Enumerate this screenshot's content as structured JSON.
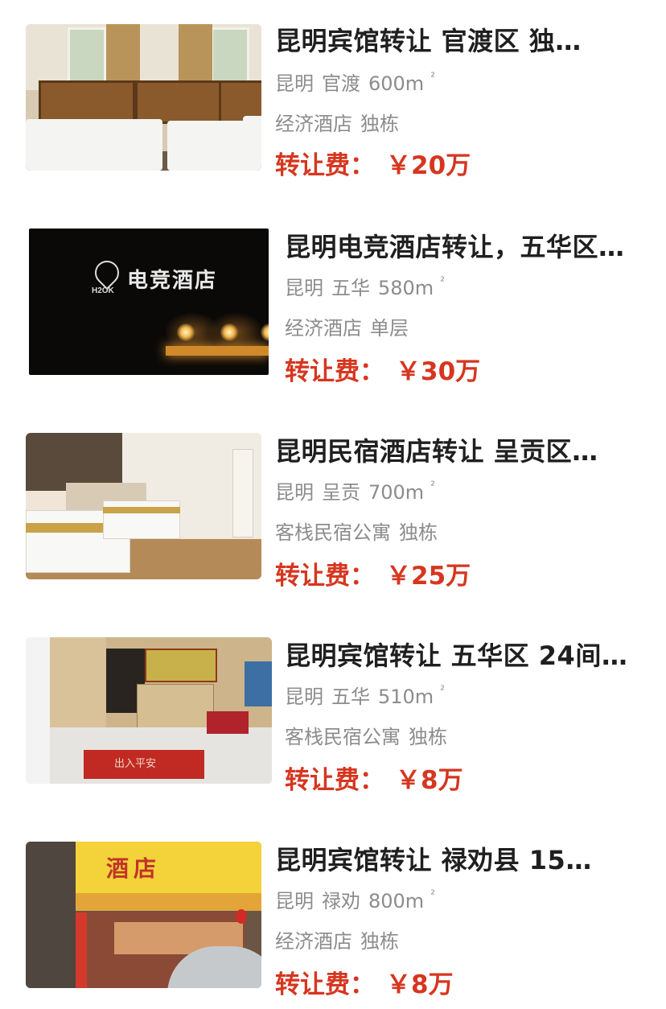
{
  "price_label": "转让费：",
  "listings": [
    {
      "title": "昆明宾馆转让 官渡区 独…",
      "city": "昆明",
      "district": "官渡",
      "area": "600m",
      "area_sup": "²",
      "type": "经济酒店",
      "building": "独栋",
      "price": "￥20万"
    },
    {
      "title": "昆明电竞酒店转让，五华区…",
      "city": "昆明",
      "district": "五华",
      "area": "580m",
      "area_sup": "²",
      "type": "经济酒店",
      "building": "单层",
      "price": "￥30万",
      "image_sign": "电竞酒店",
      "image_logo": "H2OK"
    },
    {
      "title": "昆明民宿酒店转让 呈贡区…",
      "city": "昆明",
      "district": "呈贡",
      "area": "700m",
      "area_sup": "²",
      "type": "客栈民宿公寓",
      "building": "独栋",
      "price": "￥25万"
    },
    {
      "title": "昆明宾馆转让 五华区 24间…",
      "city": "昆明",
      "district": "五华",
      "area": "510m",
      "area_sup": "²",
      "type": "客栈民宿公寓",
      "building": "独栋",
      "price": "￥8万",
      "image_mat": "出入平安"
    },
    {
      "title": "昆明宾馆转让 禄劝县 15…",
      "city": "昆明",
      "district": "禄劝",
      "area": "800m",
      "area_sup": "²",
      "type": "经济酒店",
      "building": "独栋",
      "price": "￥8万",
      "image_sign": "酒店"
    }
  ],
  "colors": {
    "title": "#1f1f1f",
    "meta": "#8c8c8c",
    "price": "#d6361f"
  }
}
